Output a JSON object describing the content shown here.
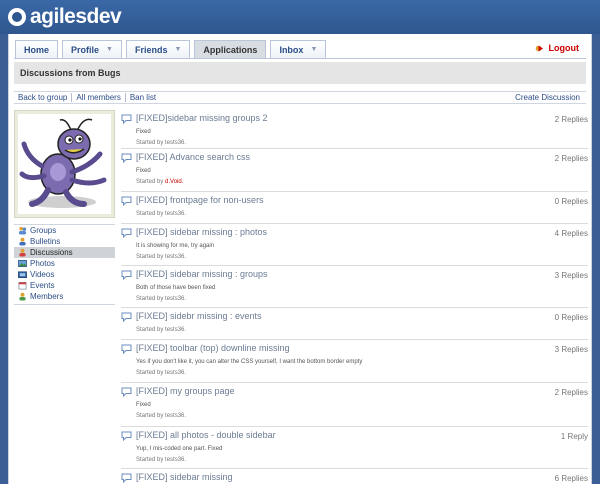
{
  "brand": {
    "name": "agilesdev"
  },
  "nav": {
    "tabs": [
      {
        "label": "Home",
        "dropdown": false
      },
      {
        "label": "Profile",
        "dropdown": true
      },
      {
        "label": "Friends",
        "dropdown": true
      },
      {
        "label": "Applications",
        "dropdown": false,
        "active": true
      },
      {
        "label": "Inbox",
        "dropdown": true
      }
    ],
    "logout_label": "Logout"
  },
  "page": {
    "title": "Discussions from Bugs"
  },
  "subnav": {
    "links": [
      "Back to group",
      "All members",
      "Ban list"
    ],
    "create_label": "Create Discussion"
  },
  "sidebar": {
    "items": [
      {
        "label": "Groups",
        "icon": "groups-icon"
      },
      {
        "label": "Bulletins",
        "icon": "bulletins-icon"
      },
      {
        "label": "Discussions",
        "icon": "discussions-icon",
        "active": true
      },
      {
        "label": "Photos",
        "icon": "photos-icon"
      },
      {
        "label": "Videos",
        "icon": "videos-icon"
      },
      {
        "label": "Events",
        "icon": "events-icon"
      },
      {
        "label": "Members",
        "icon": "members-icon"
      }
    ]
  },
  "posts": [
    {
      "title": "[FIXED]sidebar missing groups 2",
      "replies": "2 Replies",
      "snippet": "Fixed",
      "started_prefix": "Started by",
      "author": "tests36."
    },
    {
      "title": "[FIXED] Advance search css",
      "replies": "2 Replies",
      "snippet": "Fixed",
      "started_prefix": "Started by",
      "author": "d.Void.",
      "author_highlight": true
    },
    {
      "title": "[FIXED] frontpage for non-users",
      "replies": "0 Replies",
      "snippet": "",
      "started_prefix": "Started by",
      "author": "tests36."
    },
    {
      "title": "[FIXED] sidebar missing : photos",
      "replies": "4 Replies",
      "snippet": "It is showing for me, try again",
      "started_prefix": "Started by",
      "author": "tests36."
    },
    {
      "title": "[FIXED] sidebar missing : groups",
      "replies": "3 Replies",
      "snippet": "Both of those have been fixed",
      "started_prefix": "Started by",
      "author": "tests36."
    },
    {
      "title": "[FIXED] sidebr missing : events",
      "replies": "0 Replies",
      "snippet": "",
      "started_prefix": "Started by",
      "author": "tests36."
    },
    {
      "title": "[FIXED] toolbar (top) downline missing",
      "replies": "3 Replies",
      "snippet": "Yes if you don't like it, you can alter the CSS yourself, I want the bottom border empty",
      "started_prefix": "Started by",
      "author": "tests36."
    },
    {
      "title": "[FIXED] my groups page",
      "replies": "2 Replies",
      "snippet": "Fixed",
      "started_prefix": "Started by",
      "author": "tests36."
    },
    {
      "title": "[FIXED] all photos - double sidebar",
      "replies": "1 Reply",
      "snippet": "Yup, I mis-coded one part. Fixed",
      "started_prefix": "Started by",
      "author": "tests36."
    },
    {
      "title": "[FIXED] sidebar missing",
      "replies": "6 Replies",
      "snippet": "",
      "started_prefix": "",
      "author": ""
    }
  ],
  "colors": {
    "topbar": "#3a68a6",
    "link": "#2c4e86",
    "logout": "#cc0000"
  }
}
